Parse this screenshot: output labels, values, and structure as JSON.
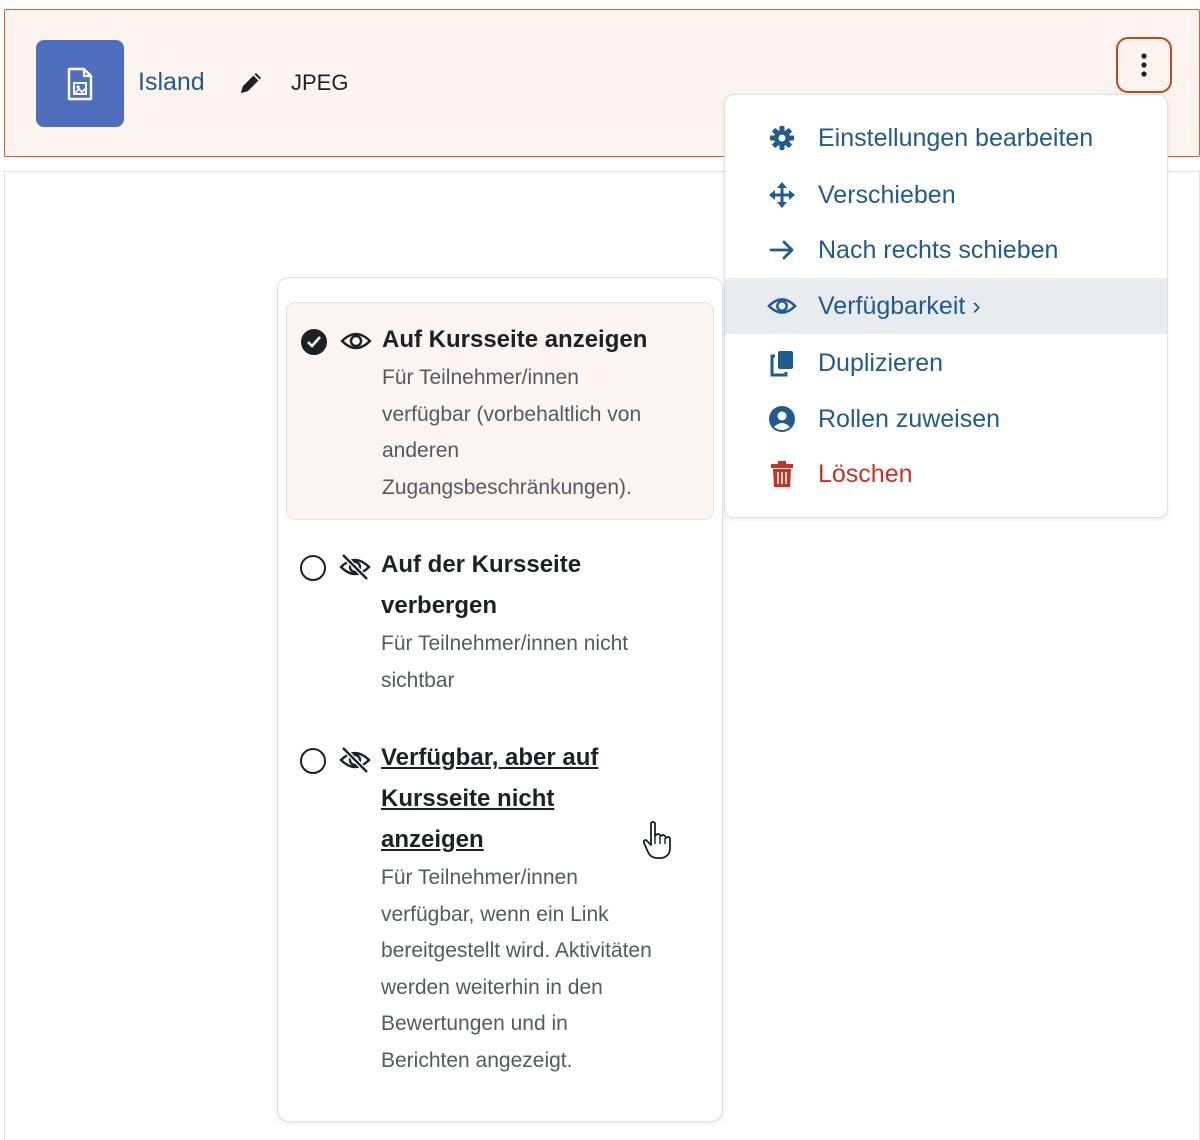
{
  "activity": {
    "name": "Island",
    "type": "JPEG",
    "icon": "image-file-icon"
  },
  "actions_menu": {
    "items": [
      {
        "label": "Einstellungen bearbeiten",
        "icon": "gear-icon"
      },
      {
        "label": "Verschieben",
        "icon": "move-arrows-icon"
      },
      {
        "label": "Nach rechts schieben",
        "icon": "arrow-right-icon"
      },
      {
        "label": "Verfügbarkeit",
        "icon": "eye-icon",
        "submenu_indicator": "›"
      },
      {
        "label": "Duplizieren",
        "icon": "copy-icon"
      },
      {
        "label": "Rollen zuweisen",
        "icon": "user-circle-icon"
      },
      {
        "label": "Löschen",
        "icon": "trash-icon"
      }
    ]
  },
  "availability_menu": {
    "options": [
      {
        "title": "Auf Kursseite anzeigen",
        "description": [
          "Für Teilnehmer/innen",
          "verfügbar (vorbehaltlich von",
          "anderen",
          "Zugangsbeschränkungen)."
        ],
        "selected": true,
        "icon": "eye-icon"
      },
      {
        "title": [
          "Auf der Kursseite",
          "verbergen"
        ],
        "description": [
          "Für Teilnehmer/innen nicht",
          "sichtbar"
        ],
        "selected": false,
        "icon": "eye-slash-icon"
      },
      {
        "title": [
          "Verfügbar, aber auf",
          "Kursseite nicht",
          "anzeigen"
        ],
        "description": [
          "Für Teilnehmer/innen",
          "verfügbar, wenn ein Link",
          "bereitgestellt wird. Aktivitäten",
          "werden weiterhin in den",
          "Bewertungen und in",
          "Berichten angezeigt."
        ],
        "selected": false,
        "icon": "eye-slash-icon"
      }
    ]
  },
  "colors": {
    "link": "#1f5b8e",
    "danger": "#ca3120",
    "accent_border": "#d9612f",
    "icon_bg": "#4f6ebd"
  }
}
